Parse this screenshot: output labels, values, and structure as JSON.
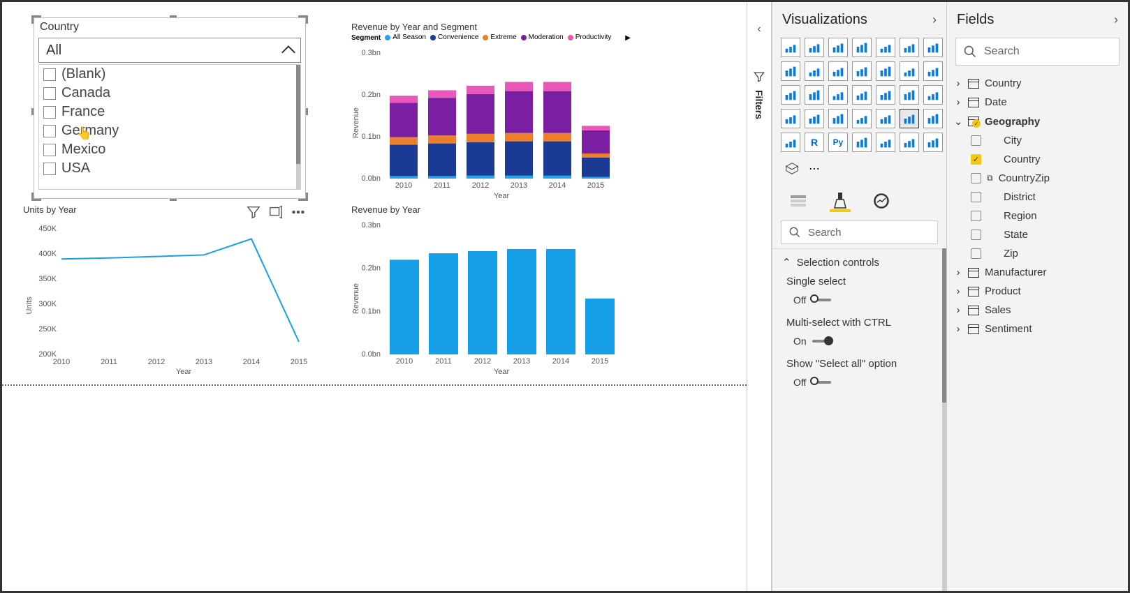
{
  "slicer": {
    "title": "Country",
    "dropdown_value": "All",
    "items": [
      "(Blank)",
      "Canada",
      "France",
      "Germany",
      "Mexico",
      "USA"
    ]
  },
  "charts_area": {
    "line": {
      "title": "Units by Year",
      "ylabel": "Units",
      "xlabel": "Year"
    },
    "stacked": {
      "title": "Revenue by Year and Segment",
      "legend_label": "Segment",
      "ylabel": "Revenue",
      "xlabel": "Year"
    },
    "bar": {
      "title": "Revenue by Year",
      "ylabel": "Revenue",
      "xlabel": "Year"
    }
  },
  "chart_data": [
    {
      "type": "line",
      "title": "Units by Year",
      "xlabel": "Year",
      "ylabel": "Units",
      "x": [
        2010,
        2011,
        2012,
        2013,
        2014,
        2015
      ],
      "values": [
        390000,
        392000,
        395000,
        398000,
        430000,
        225000
      ],
      "ylim": [
        200000,
        450000
      ],
      "y_ticks": [
        "200K",
        "250K",
        "300K",
        "350K",
        "400K",
        "450K"
      ]
    },
    {
      "type": "bar",
      "stacked": true,
      "title": "Revenue by Year and Segment",
      "xlabel": "Year",
      "ylabel": "Revenue",
      "categories": [
        2010,
        2011,
        2012,
        2013,
        2014,
        2015
      ],
      "series": [
        {
          "name": "All Season",
          "color": "#2aa3ef",
          "values": [
            0.006,
            0.006,
            0.007,
            0.007,
            0.007,
            0.004
          ]
        },
        {
          "name": "Convenience",
          "color": "#1b3a93",
          "values": [
            0.075,
            0.078,
            0.08,
            0.082,
            0.082,
            0.046
          ]
        },
        {
          "name": "Extreme",
          "color": "#eb7f2d",
          "values": [
            0.018,
            0.019,
            0.02,
            0.02,
            0.02,
            0.01
          ]
        },
        {
          "name": "Moderation",
          "color": "#7b1fa2",
          "values": [
            0.082,
            0.09,
            0.095,
            0.1,
            0.1,
            0.055
          ]
        },
        {
          "name": "Productivity",
          "color": "#e858b9",
          "values": [
            0.017,
            0.018,
            0.02,
            0.022,
            0.022,
            0.011
          ]
        }
      ],
      "ylim": [
        0,
        0.3
      ],
      "y_ticks": [
        "0.0bn",
        "0.1bn",
        "0.2bn",
        "0.3bn"
      ],
      "unit": "bn"
    },
    {
      "type": "bar",
      "title": "Revenue by Year",
      "xlabel": "Year",
      "ylabel": "Revenue",
      "categories": [
        2010,
        2011,
        2012,
        2013,
        2014,
        2015
      ],
      "values": [
        0.22,
        0.235,
        0.24,
        0.245,
        0.245,
        0.13
      ],
      "ylim": [
        0,
        0.3
      ],
      "y_ticks": [
        "0.0bn",
        "0.1bn",
        "0.2bn",
        "0.3bn"
      ],
      "unit": "bn"
    }
  ],
  "filters_pane": {
    "label": "Filters"
  },
  "viz_pane": {
    "title": "Visualizations",
    "search_placeholder": "Search",
    "section": "Selection controls",
    "controls": {
      "single_select": {
        "label": "Single select",
        "state": "Off"
      },
      "multi_ctrl": {
        "label": "Multi-select with CTRL",
        "state": "On"
      },
      "select_all": {
        "label": "Show \"Select all\" option",
        "state": "Off"
      }
    }
  },
  "fields_pane": {
    "title": "Fields",
    "search_placeholder": "Search",
    "tables": [
      {
        "name": "Country",
        "expanded": false
      },
      {
        "name": "Date",
        "expanded": false
      },
      {
        "name": "Geography",
        "expanded": true,
        "active": true,
        "fields": [
          {
            "name": "City",
            "checked": false
          },
          {
            "name": "Country",
            "checked": true
          },
          {
            "name": "CountryZip",
            "checked": false,
            "hierarchy": true
          },
          {
            "name": "District",
            "checked": false
          },
          {
            "name": "Region",
            "checked": false
          },
          {
            "name": "State",
            "checked": false
          },
          {
            "name": "Zip",
            "checked": false
          }
        ]
      },
      {
        "name": "Manufacturer",
        "expanded": false
      },
      {
        "name": "Product",
        "expanded": false
      },
      {
        "name": "Sales",
        "expanded": false
      },
      {
        "name": "Sentiment",
        "expanded": false
      }
    ]
  },
  "colors": {
    "blue": "#169fe6",
    "navy": "#1b3a93",
    "orange": "#eb7f2d",
    "purple": "#7b1fa2",
    "pink": "#e858b9",
    "yellow": "#f2c811"
  }
}
